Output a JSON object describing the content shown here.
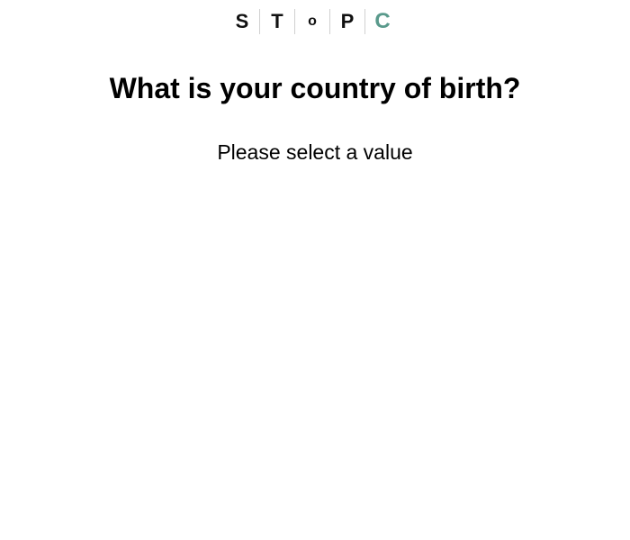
{
  "logo": {
    "letters": [
      "S",
      "T",
      "o",
      "P",
      "C"
    ],
    "accent_color": "#5a9a8c"
  },
  "question": {
    "title": "What is your country of birth?"
  },
  "form": {
    "instruction": "Please select a value"
  }
}
